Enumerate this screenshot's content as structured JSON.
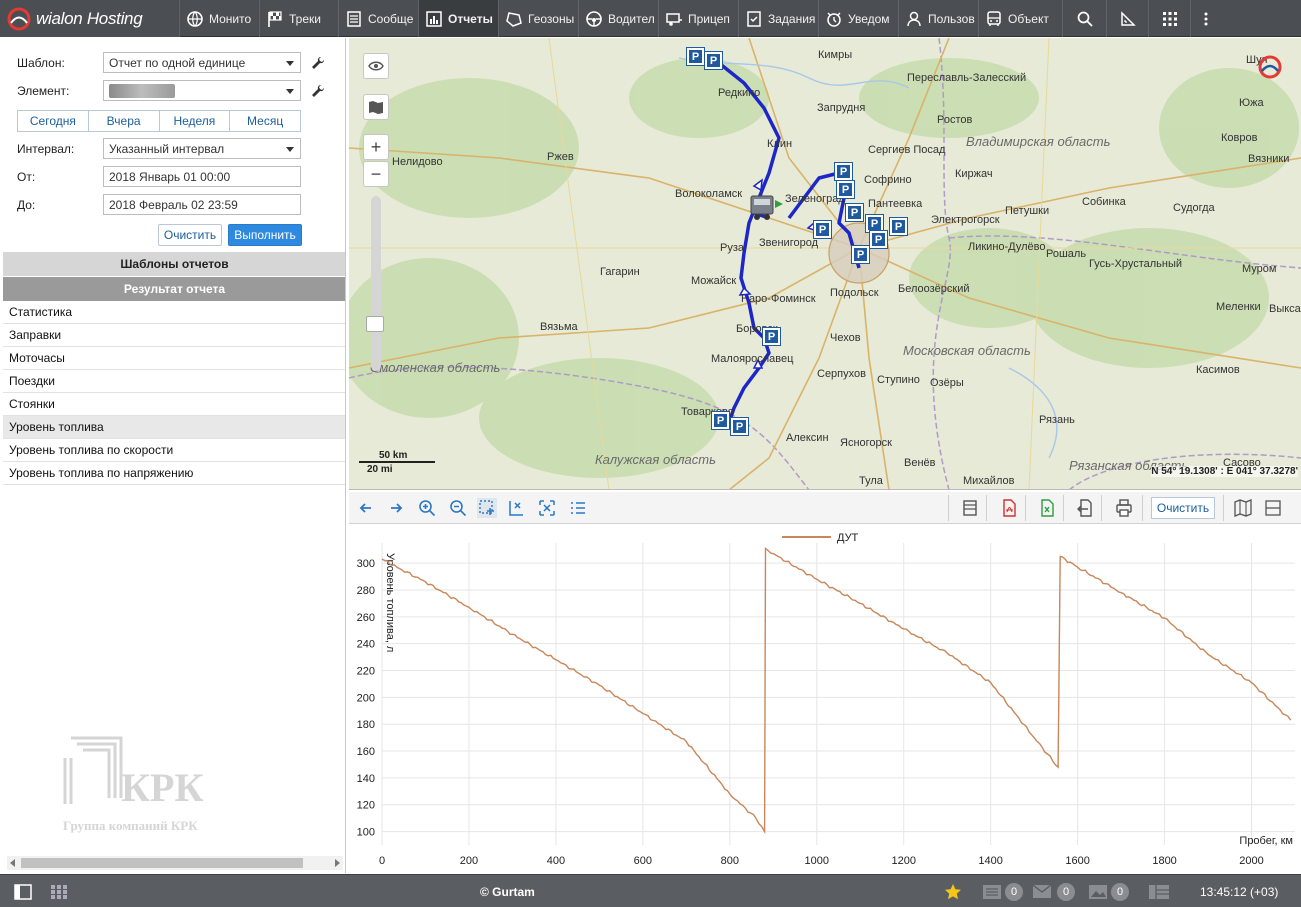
{
  "app": {
    "logo_text": "wialon Hosting"
  },
  "nav": [
    {
      "label": "Монито",
      "icon": "eye-globe-icon"
    },
    {
      "label": "Треки",
      "icon": "checkered-flag-icon"
    },
    {
      "label": "Сообщe",
      "icon": "messages-icon"
    },
    {
      "label": "Отчеты",
      "icon": "report-icon",
      "active": true
    },
    {
      "label": "Геозоны",
      "icon": "geofence-icon"
    },
    {
      "label": "Водител",
      "icon": "steering-wheel-icon"
    },
    {
      "label": "Прицеп",
      "icon": "trailer-icon"
    },
    {
      "label": "Задания",
      "icon": "task-icon"
    },
    {
      "label": "Уведом",
      "icon": "alarm-clock-icon"
    },
    {
      "label": "Пользов",
      "icon": "user-icon"
    },
    {
      "label": "Объект",
      "icon": "bus-icon"
    }
  ],
  "form": {
    "template_label": "Шаблон:",
    "template_value": "Отчет по одной единице",
    "element_label": "Элемент:",
    "interval_label": "Интервал:",
    "interval_value": "Указанный интервал",
    "from_label": "От:",
    "from_value": "2018 Январь 01 00:00",
    "to_label": "До:",
    "to_value": "2018 Февраль 02 23:59",
    "quick": [
      "Сегодня",
      "Вчера",
      "Неделя",
      "Месяц"
    ],
    "clear_label": "Очистить",
    "execute_label": "Выполнить"
  },
  "sections": {
    "templates": "Шаблоны отчетов",
    "result": "Результат отчета"
  },
  "result_items": [
    "Статистика",
    "Заправки",
    "Моточасы",
    "Поездки",
    "Стоянки",
    "Уровень топлива",
    "Уровень топлива по скорости",
    "Уровень топлива по напряжению"
  ],
  "selected_result": 5,
  "watermark": {
    "title": "КРК",
    "subtitle": "Группа компаний КРК"
  },
  "map": {
    "cities": [
      {
        "name": "Кимры"
      },
      {
        "name": "Переславль-Залесский"
      },
      {
        "name": "Шуя"
      },
      {
        "name": "Южа"
      },
      {
        "name": "Редкино"
      },
      {
        "name": "Запрудня"
      },
      {
        "name": "Ростов"
      },
      {
        "name": "Клин"
      },
      {
        "name": "Сергиев Посад"
      },
      {
        "name": "Ковров"
      },
      {
        "name": "Нелидово"
      },
      {
        "name": "Ржев"
      },
      {
        "name": "Софрино"
      },
      {
        "name": "Киржач"
      },
      {
        "name": "Вязники"
      },
      {
        "name": "Волоколамск"
      },
      {
        "name": "Пантеевка"
      },
      {
        "name": "Петушки"
      },
      {
        "name": "Собинка"
      },
      {
        "name": "Судогда"
      },
      {
        "name": "Электрогорск"
      },
      {
        "name": "Звенигород"
      },
      {
        "name": "Ликино-Дулёво"
      },
      {
        "name": "Руза"
      },
      {
        "name": "Рошаль"
      },
      {
        "name": "Гусь-Хрустальный"
      },
      {
        "name": "Гагарин"
      },
      {
        "name": "Можайск"
      },
      {
        "name": "Подольск"
      },
      {
        "name": "Белоозёрский"
      },
      {
        "name": "Муром"
      },
      {
        "name": "Наро-Фоминск"
      },
      {
        "name": "Меленки"
      },
      {
        "name": "Выкса"
      },
      {
        "name": "Вязьма"
      },
      {
        "name": "Боровск"
      },
      {
        "name": "Чехов"
      },
      {
        "name": "Малоярославец"
      },
      {
        "name": "Серпухов"
      },
      {
        "name": "Ступино"
      },
      {
        "name": "Озёры"
      },
      {
        "name": "Касимов"
      },
      {
        "name": "Товарково"
      },
      {
        "name": "Рязань"
      },
      {
        "name": "Алексин"
      },
      {
        "name": "Ясногорск"
      },
      {
        "name": "Венёв"
      },
      {
        "name": "Михайлов"
      },
      {
        "name": "Сасово"
      },
      {
        "name": "Тула"
      },
      {
        "name": "Зеленоград"
      }
    ],
    "regions": [
      {
        "name": "Владимирская область"
      },
      {
        "name": "Московская область"
      },
      {
        "name": "Смоленская область"
      },
      {
        "name": "Калужская область"
      },
      {
        "name": "Рязанская область"
      }
    ],
    "scale_km": "50 km",
    "scale_mi": "20 mi",
    "coords": "N 54° 19.1308' : E 041° 37.3278'",
    "parking_label": "P"
  },
  "chart_toolbar": {
    "clear_label": "Очистить"
  },
  "chart_data": {
    "type": "line",
    "legend": [
      "ДУТ"
    ],
    "ylabel": "Уровень топлива, л",
    "xlabel": "Пробег, км",
    "xlim": [
      0,
      2100
    ],
    "ylim": [
      90,
      315
    ],
    "x_ticks": [
      0,
      200,
      400,
      600,
      800,
      1000,
      1200,
      1400,
      1600,
      1800,
      2000
    ],
    "y_ticks": [
      100,
      120,
      140,
      160,
      180,
      200,
      220,
      240,
      260,
      280,
      300
    ],
    "grid": true,
    "series": [
      {
        "name": "ДУТ",
        "color": "#c8875a",
        "x": [
          0,
          40,
          100,
          200,
          300,
          400,
          500,
          600,
          700,
          800,
          860,
          880,
          882,
          900,
          1000,
          1100,
          1200,
          1300,
          1400,
          1500,
          1555,
          1560,
          1600,
          1700,
          1800,
          1900,
          2000,
          2090
        ],
        "y": [
          303,
          296,
          286,
          267,
          247,
          228,
          209,
          188,
          167,
          128,
          110,
          100,
          311,
          307,
          288,
          270,
          251,
          233,
          211,
          170,
          148,
          305,
          297,
          278,
          259,
          232,
          211,
          183
        ]
      }
    ]
  },
  "status": {
    "copyright": "© Gurtam",
    "badge_messages": "0",
    "badge_mail": "0",
    "badge_images": "0",
    "time": "13:45:12 (+03)"
  }
}
